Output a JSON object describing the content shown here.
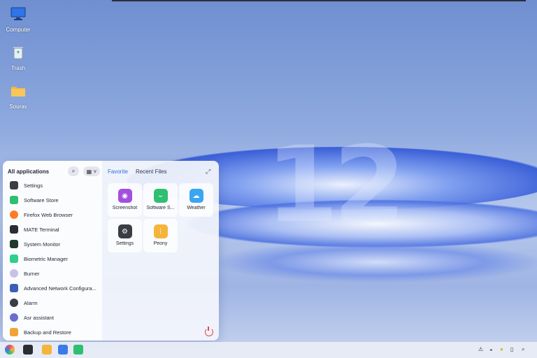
{
  "desktop": {
    "icons": [
      {
        "label": "Computer",
        "icon": "monitor-icon"
      },
      {
        "label": "Trash",
        "icon": "trash-icon"
      },
      {
        "label": "Sourav",
        "icon": "folder-icon"
      }
    ]
  },
  "wallpaper": {
    "version_text": "12"
  },
  "start_menu": {
    "title": "All applications",
    "search_icon": "search-icon",
    "view_icon": "grid-view-icon",
    "apps": [
      {
        "label": "Settings",
        "icon": "settings-icon",
        "color": "#3a3d44"
      },
      {
        "label": "Software Store",
        "icon": "store-icon",
        "color": "#2fbf71"
      },
      {
        "label": "Firefox Web Browser",
        "icon": "firefox-icon",
        "color": "#ff7b27"
      },
      {
        "label": "MATE Terminal",
        "icon": "terminal-icon",
        "color": "#2a2d33"
      },
      {
        "label": "System Monitor",
        "icon": "monitor-icon",
        "color": "#1f3a2a"
      },
      {
        "label": "Biometric Manager",
        "icon": "fingerprint-icon",
        "color": "#2fce8a"
      },
      {
        "label": "Burner",
        "icon": "disc-icon",
        "color": "#c9c2e6"
      },
      {
        "label": "Advanced Network Configura...",
        "icon": "network-icon",
        "color": "#3c5fb5"
      },
      {
        "label": "Alarm",
        "icon": "alarm-icon",
        "color": "#3a3d44"
      },
      {
        "label": "Asr assistant",
        "icon": "assistant-icon",
        "color": "#6a6fcf"
      },
      {
        "label": "Backup and Restore",
        "icon": "backup-icon",
        "color": "#f2a23a"
      }
    ],
    "tabs": [
      {
        "label": "Favorite",
        "active": true
      },
      {
        "label": "Recent Files",
        "active": false
      }
    ],
    "favorites": [
      {
        "label": "Screenshot",
        "icon": "screenshot-icon",
        "color": "#a24fe0"
      },
      {
        "label": "Software S...",
        "icon": "store-icon",
        "color": "#2fbf71"
      },
      {
        "label": "Weather",
        "icon": "weather-icon",
        "color": "#3aa5f0"
      },
      {
        "label": "Settings",
        "icon": "settings-icon",
        "color": "#3a3d44"
      },
      {
        "label": "Peony",
        "icon": "file-manager-icon",
        "color": "#f5b43a"
      }
    ],
    "power_icon": "power-icon"
  },
  "taskbar": {
    "items": [
      {
        "icon": "start-menu-icon",
        "color": "#e84c6a"
      },
      {
        "icon": "multitask-icon",
        "color": "#2a2d33"
      },
      {
        "icon": "file-manager-icon",
        "color": "#f5b43a"
      },
      {
        "icon": "wps-writer-icon",
        "color": "#3a7be8"
      },
      {
        "icon": "store-icon",
        "color": "#2fbf71"
      }
    ],
    "tray": [
      "network-icon",
      "connection-icon",
      "sun-icon",
      "battery-icon",
      "search-icon"
    ]
  }
}
